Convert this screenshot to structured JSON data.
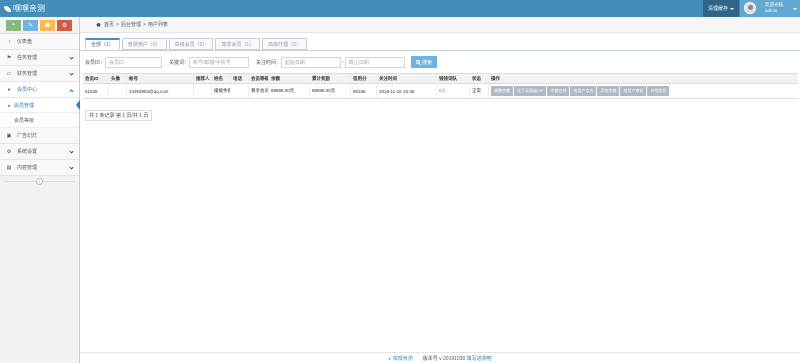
{
  "header": {
    "app_title": "嘿嘿亲测",
    "cache_button": "清理缓存",
    "welcome_line": "欢迎光临,",
    "username": "admin"
  },
  "sidebar": {
    "items": [
      {
        "label": "仪表盘",
        "icon": "tachometer-icon",
        "has_arrow": false
      },
      {
        "label": "任务管理",
        "icon": "flag-icon",
        "has_arrow": true
      },
      {
        "label": "财务管理",
        "icon": "hdd-icon",
        "has_arrow": true
      },
      {
        "label": "会员中心",
        "icon": "user-icon",
        "has_arrow": true,
        "active": true
      },
      {
        "label": "广告幻灯",
        "icon": "image-icon",
        "has_arrow": false
      },
      {
        "label": "系统设置",
        "icon": "cogs-icon",
        "has_arrow": true
      },
      {
        "label": "内容管理",
        "icon": "folder-icon",
        "has_arrow": true
      }
    ],
    "sub_items": [
      {
        "label": "会员管理",
        "current": true
      },
      {
        "label": "会员等级",
        "current": false
      }
    ],
    "collapse_glyph": "«"
  },
  "breadcrumb": {
    "home": "首页",
    "sep": ">",
    "section": "后台管理",
    "page": "用户列表"
  },
  "tabs": [
    {
      "label": "全部（1）",
      "active": true
    },
    {
      "label": "普通用户（0）",
      "active": false
    },
    {
      "label": "高级会员（0）",
      "active": false
    },
    {
      "label": "尊享会员（1）",
      "active": false
    },
    {
      "label": "高级代理（0）",
      "active": false
    }
  ],
  "filter": {
    "member_id_label": "会员ID：",
    "member_id_placeholder": "会员ID",
    "keyword_label": "关键词：",
    "keyword_placeholder": "帐号/邮箱/手机号",
    "time_label": "关注时间：",
    "start_placeholder": "起始日期",
    "dash": "-",
    "end_placeholder": "截止日期",
    "search_button": "搜索"
  },
  "table": {
    "columns": [
      "会员ID",
      "头像",
      "帐号",
      "推荐人",
      "姓名",
      "电话",
      "会员等级",
      "余额",
      "累计奖励",
      "信用分",
      "关注时间",
      "钱钱词队",
      "状态",
      "操作"
    ],
    "rows": [
      {
        "id": "51536",
        "avatar": "",
        "account": "34363983@qq.com",
        "referrer": "",
        "name": "缓缓余则",
        "phone": "",
        "level": "尊享会员",
        "balance": "88888.00元",
        "reward": "88888.00元",
        "credit": "89188",
        "follow_time": "2019-11-16 15:45",
        "team": "0人",
        "status": "正常",
        "actions": [
          "调整余额",
          "设下无限级VIP",
          "余额在线",
          "给用户点名",
          "添加余额",
          "给用户审核",
          "详细信息"
        ]
      }
    ]
  },
  "pager": {
    "text": "共 1 条记录 第 1 页/共 1 页"
  },
  "footer": {
    "brand": "嘿嘿亲测",
    "version_prefix": "版本号 v 20191030",
    "version_link": "填写进测吧"
  }
}
